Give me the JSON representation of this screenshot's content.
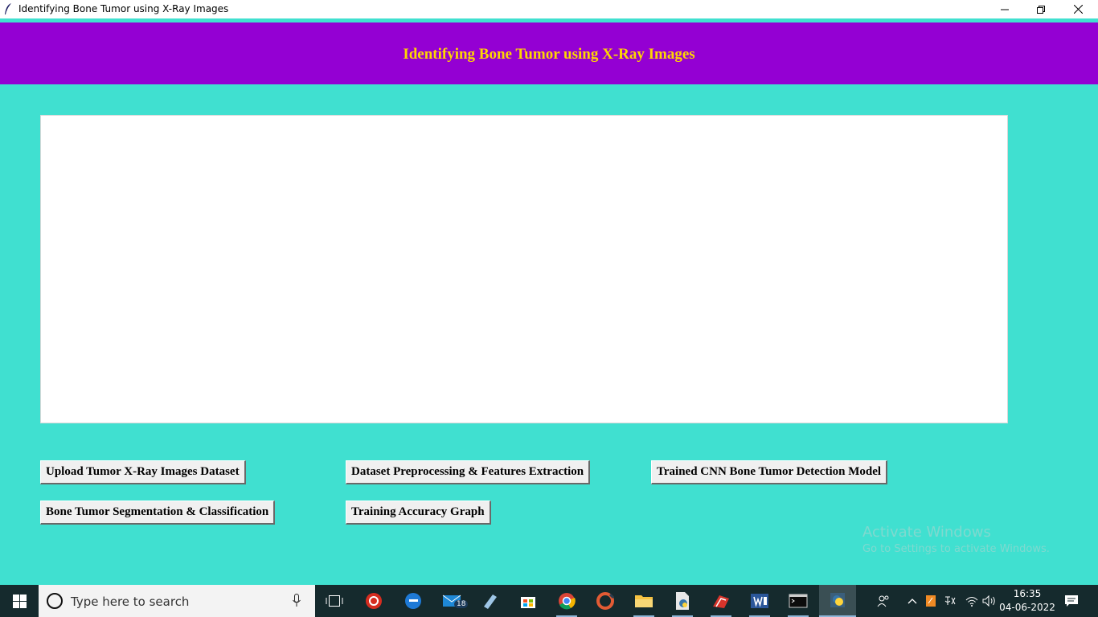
{
  "window": {
    "title": "Identifying Bone Tumor using X-Ray Images"
  },
  "header": {
    "title": "Identifying Bone Tumor using X-Ray Images",
    "bg_color": "#9400d3",
    "text_color": "#ffd700"
  },
  "background_color": "#40e0d0",
  "output_text": "",
  "buttons": {
    "upload": "Upload Tumor X-Ray Images Dataset",
    "preprocess": "Dataset Preprocessing & Features Extraction",
    "train": "Trained CNN Bone Tumor Detection Model",
    "segment": "Bone Tumor Segmentation & Classification",
    "graph": "Training Accuracy Graph"
  },
  "watermark": {
    "line1": "Activate Windows",
    "line2": "Go to Settings to activate Windows."
  },
  "taskbar": {
    "search_placeholder": "Type here to search",
    "mail_badge": "18",
    "clock_time": "16:35",
    "clock_date": "04-06-2022",
    "icons": [
      "windows-start-icon",
      "task-view-icon",
      "antivirus-icon",
      "edge-icon",
      "mail-icon",
      "paint-icon",
      "store-icon",
      "chrome-icon",
      "ccleaner-icon",
      "file-explorer-icon",
      "python-file-icon",
      "image-app-icon",
      "word-icon",
      "terminal-icon",
      "python-idle-icon"
    ]
  }
}
